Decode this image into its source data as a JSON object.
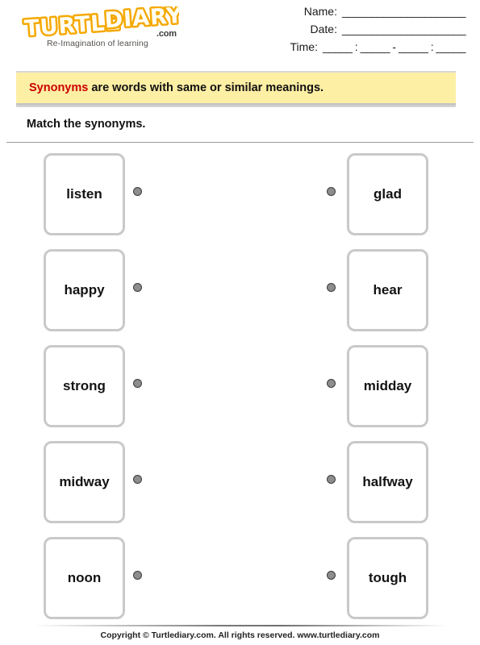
{
  "header": {
    "logo": {
      "wordmark": "TURTLE DIARY",
      "dotcom": ".com",
      "tagline": "Re-Imagination of learning",
      "color_primary": "#f5a800",
      "color_fill": "#ffd24d"
    },
    "fields": [
      {
        "label": "Name:",
        "line": "_____________________"
      },
      {
        "label": "Date:",
        "line": "_____________________"
      },
      {
        "label": "Time:",
        "line": "_____ : _____ - _____ : _____"
      }
    ]
  },
  "banner": {
    "keyword": "Synonyms",
    "keyword_color": "#cc0000",
    "text": " are words with same or similar meanings.",
    "background": "#fdefa4"
  },
  "instruction": "Match the synonyms.",
  "match": {
    "rows": [
      {
        "left": "listen",
        "right": "glad"
      },
      {
        "left": "happy",
        "right": "hear"
      },
      {
        "left": "strong",
        "right": "midday"
      },
      {
        "left": "midway",
        "right": "halfway"
      },
      {
        "left": "noon",
        "right": "tough"
      }
    ]
  },
  "footer": {
    "copyright": "Copyright © Turtlediary.com. All rights reserved. www.turtlediary.com"
  }
}
